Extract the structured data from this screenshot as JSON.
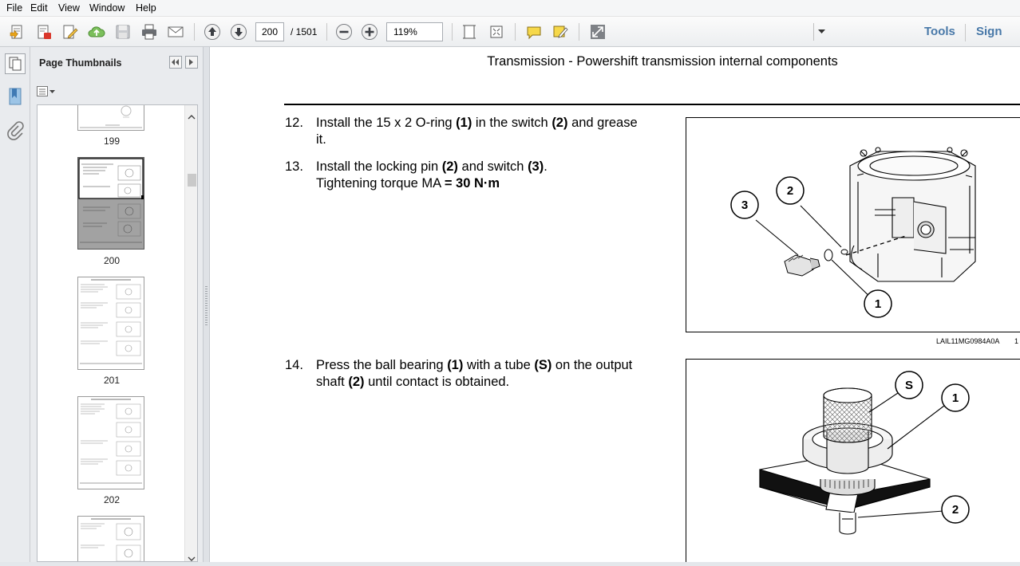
{
  "menu": [
    "File",
    "Edit",
    "View",
    "Window",
    "Help"
  ],
  "toolbar": {
    "current_page": "200",
    "total_pages": "/ 1501",
    "zoom": "119%",
    "tools_label": "Tools",
    "sign_label": "Sign"
  },
  "panel": {
    "title": "Page Thumbnails",
    "thumbnails": [
      {
        "label": "199"
      },
      {
        "label": "200"
      },
      {
        "label": "201"
      },
      {
        "label": "202"
      }
    ]
  },
  "document": {
    "title": "Transmission - Powershift transmission internal components",
    "steps": [
      {
        "num": "12.",
        "line1_a": "Install the 15 x 2 O-ring ",
        "line1_b": "(1)",
        "line1_c": " in the switch ",
        "line1_d": "(2)",
        "line1_e": " and grease",
        "line2": "it."
      },
      {
        "num": "13.",
        "line1_a": "Install the locking pin ",
        "line1_b": "(2)",
        "line1_c": " and switch ",
        "line1_d": "(3)",
        "line1_e": ".",
        "line2_a": "Tightening torque MA ",
        "line2_b": "= 30 N·m"
      },
      {
        "num": "14.",
        "line1_a": "Press the ball bearing ",
        "line1_b": "(1)",
        "line1_c": " with a tube ",
        "line1_d": "(S)",
        "line1_e": " on the output",
        "line2_a": "shaft ",
        "line2_b": "(2)",
        "line2_c": " until contact is obtained."
      }
    ],
    "figure1": {
      "callouts": [
        "3",
        "2",
        "1"
      ],
      "caption": "LAIL11MG0984A0A",
      "caption_num": "1"
    },
    "figure2": {
      "callouts": [
        "S",
        "1",
        "2"
      ]
    }
  }
}
